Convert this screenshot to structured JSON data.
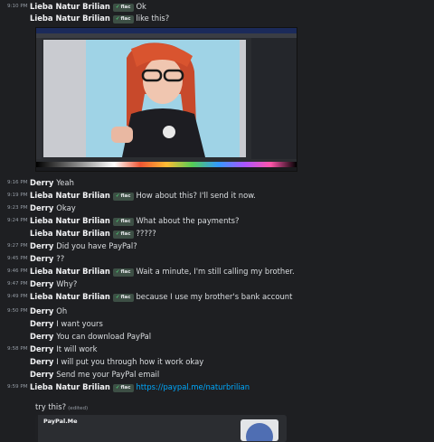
{
  "messages": [
    {
      "time": "9:10 PM",
      "author": "Lieba Natur Brilian",
      "badge": "flac",
      "text": "Ok"
    },
    {
      "time": "",
      "author": "Lieba Natur Brilian",
      "badge": "flac",
      "text": "like this?"
    },
    {
      "time": "9:16 PM",
      "author": "Derry",
      "badge": "",
      "text": "Yeah"
    },
    {
      "time": "9:19 PM",
      "author": "Lieba Natur Brilian",
      "badge": "flac",
      "text": "How about this? I'll send it now."
    },
    {
      "time": "9:23 PM",
      "author": "Derry",
      "badge": "",
      "text": "Okay"
    },
    {
      "time": "9:24 PM",
      "author": "Lieba Natur Brilian",
      "badge": "flac",
      "text": "What about the payments?"
    },
    {
      "time": "",
      "author": "Lieba Natur Brilian",
      "badge": "flac",
      "text": "?????"
    },
    {
      "time": "9:27 PM",
      "author": "Derry",
      "badge": "",
      "text": "Did you have PayPal?"
    },
    {
      "time": "9:45 PM",
      "author": "Derry",
      "badge": "",
      "text": "??"
    },
    {
      "time": "9:46 PM",
      "author": "Lieba Natur Brilian",
      "badge": "flac",
      "text": "Wait a minute, I'm still calling my brother."
    },
    {
      "time": "9:47 PM",
      "author": "Derry",
      "badge": "",
      "text": "Why?"
    },
    {
      "time": "9:49 PM",
      "author": "Lieba Natur Brilian",
      "badge": "flac",
      "text": "because I use my brother's bank account"
    },
    {
      "time": "9:50 PM",
      "author": "Derry",
      "badge": "",
      "text": "Oh"
    },
    {
      "time": "",
      "author": "Derry",
      "badge": "",
      "text": "I want yours"
    },
    {
      "time": "",
      "author": "Derry",
      "badge": "",
      "text": "You can download PayPal"
    },
    {
      "time": "9:58 PM",
      "author": "Derry",
      "badge": "",
      "text": "It will work"
    },
    {
      "time": "",
      "author": "Derry",
      "badge": "",
      "text": "I will put you through how it work okay"
    },
    {
      "time": "",
      "author": "Derry",
      "badge": "",
      "text": "Send me your PayPal email"
    },
    {
      "time": "9:59 PM",
      "author": "Lieba Natur Brilian",
      "badge": "flac",
      "text": "https://paypal.me/naturbrilian"
    }
  ],
  "continuation": {
    "text": "try this?",
    "edited": "(edited)"
  },
  "embed": {
    "title": "PayPal.Me"
  },
  "colors": {
    "background": "#1e1f22",
    "link": "#00a8fc",
    "badge_check": "#57f287"
  }
}
